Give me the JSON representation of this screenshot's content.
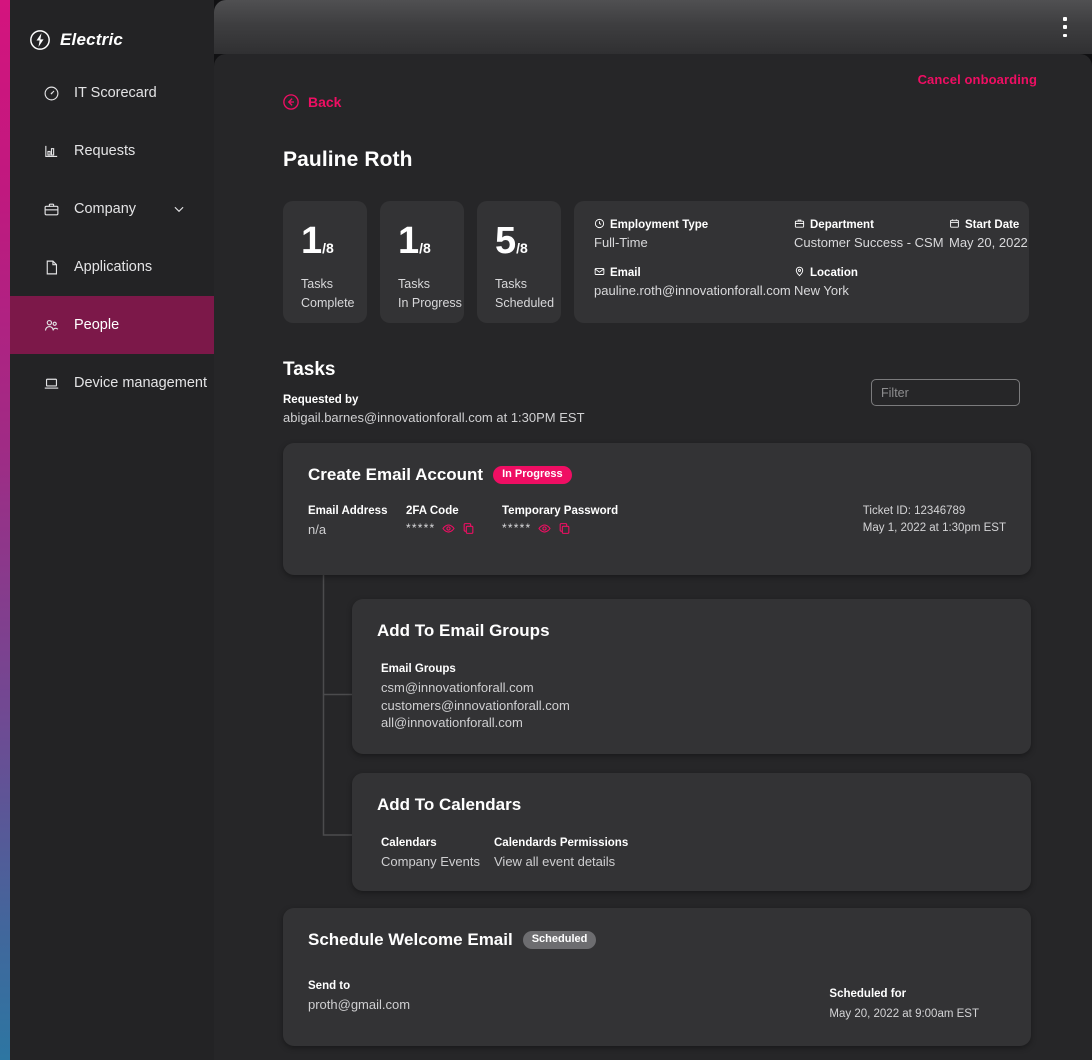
{
  "brand": {
    "name": "Electric",
    "logo_icon": "electric-bolt-logo"
  },
  "sidebar": {
    "items": [
      {
        "label": "IT Scorecard",
        "icon": "gauge-icon",
        "active": false
      },
      {
        "label": "Requests",
        "icon": "bar-chart-icon",
        "active": false
      },
      {
        "label": "Company",
        "icon": "briefcase-icon",
        "active": false,
        "expandable": true
      },
      {
        "label": "Applications",
        "icon": "document-icon",
        "active": false
      },
      {
        "label": "People",
        "icon": "people-icon",
        "active": true
      },
      {
        "label": "Device management",
        "icon": "laptop-icon",
        "active": false
      }
    ]
  },
  "topbar": {
    "kebab_icon": "more-vertical-icon"
  },
  "header": {
    "cancel_label": "Cancel onboarding",
    "back_label": "Back",
    "back_icon": "arrow-left-circle-icon",
    "page_title": "Pauline Roth"
  },
  "stats": [
    {
      "value": "1",
      "denominator": "/8",
      "line1": "Tasks",
      "line2": "Complete"
    },
    {
      "value": "1",
      "denominator": "/8",
      "line1": "Tasks",
      "line2": "In Progress"
    },
    {
      "value": "5",
      "denominator": "/8",
      "line1": "Tasks",
      "line2": "Scheduled"
    }
  ],
  "meta": {
    "employment_type": {
      "label": "Employment Type",
      "icon": "clock-icon",
      "value": "Full-Time"
    },
    "department": {
      "label": "Department",
      "icon": "briefcase-icon",
      "value": "Customer Success - CSM"
    },
    "start_date": {
      "label": "Start Date",
      "icon": "calendar-icon",
      "value": "May 20, 2022"
    },
    "email": {
      "label": "Email",
      "icon": "envelope-icon",
      "value": "pauline.roth@innovationforall.com"
    },
    "location": {
      "label": "Location",
      "icon": "pin-icon",
      "value": "New York"
    }
  },
  "tasks_section": {
    "title": "Tasks",
    "requested_by_label": "Requested by",
    "requested_by_value": "abigail.barnes@innovationforall.com at 1:30PM EST",
    "filter_placeholder": "Filter",
    "filter_value": ""
  },
  "tasks": [
    {
      "title": "Create Email Account",
      "status": "In Progress",
      "status_type": "progress",
      "fields": {
        "email_label": "Email Address",
        "email_value": "n/a",
        "twofa_label": "2FA Code",
        "twofa_value": "*****",
        "temp_label": "Temporary Password",
        "temp_value": "*****"
      },
      "ticket_id": "Ticket ID: 12346789",
      "timestamp": "May 1, 2022 at 1:30pm EST",
      "eye_icon": "eye-icon",
      "copy_icon": "copy-icon"
    },
    {
      "title": "Add To Email Groups",
      "groups_label": "Email Groups",
      "groups": [
        "csm@innovationforall.com",
        "customers@innovationforall.com",
        "all@innovationforall.com"
      ]
    },
    {
      "title": "Add To Calendars",
      "calendars_label": "Calendars",
      "calendars_value": "Company Events",
      "permissions_label": "Calendards Permissions",
      "permissions_value": "View all event details"
    },
    {
      "title": "Schedule Welcome Email",
      "status": "Scheduled",
      "status_type": "scheduled",
      "send_to_label": "Send to",
      "send_to_value": "proth@gmail.com",
      "scheduled_for_label": "Scheduled for",
      "scheduled_for_value": "May 20, 2022 at 9:00am EST"
    }
  ],
  "colors": {
    "accent_pink": "#ef0e63",
    "sidebar_bg": "#232325",
    "active_nav": "#7c1849",
    "card_bg": "#333335",
    "panel_bg": "#262628"
  }
}
